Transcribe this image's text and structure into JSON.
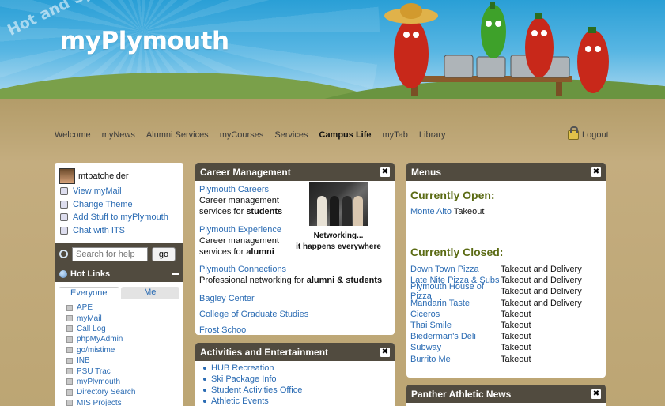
{
  "header": {
    "tagline": "Hot and Spicy!",
    "logo": "myPlymouth"
  },
  "nav": {
    "items": [
      "Welcome",
      "myNews",
      "Alumni Services",
      "myCourses",
      "Services",
      "Campus Life",
      "myTab",
      "Library"
    ],
    "active": "Campus Life",
    "logout": "Logout"
  },
  "sidebar": {
    "username": "mtbatchelder",
    "actions": [
      "View myMail",
      "Change Theme",
      "Add Stuff to myPlymouth",
      "Chat with ITS"
    ],
    "search": {
      "placeholder": "Search for help",
      "button": "go"
    },
    "hot_links": {
      "title": "Hot Links",
      "tabs": [
        "Everyone",
        "Me"
      ],
      "items": [
        "APE",
        "myMail",
        "Call Log",
        "phpMyAdmin",
        "go/mistime",
        "INB",
        "PSU Trac",
        "myPlymouth",
        "Directory Search",
        "MIS Projects"
      ]
    }
  },
  "career": {
    "title": "Career Management",
    "items": [
      {
        "link": "Plymouth Careers",
        "desc": "Career management services for",
        "bold": "students"
      },
      {
        "link": "Plymouth Experience",
        "desc": "Career management services for",
        "bold": "alumni"
      },
      {
        "link": "Plymouth Connections",
        "desc": "Professional networking for",
        "bold": "alumni & students"
      }
    ],
    "more_links": [
      "Bagley Center",
      "College of Graduate Studies",
      "Frost School"
    ],
    "caption_line1": "Networking...",
    "caption_line2": "it happens everywhere"
  },
  "activities": {
    "title": "Activities and Entertainment",
    "items": [
      "HUB Recreation",
      "Ski Package Info",
      "Student Activities Office",
      "Athletic Events"
    ]
  },
  "menus": {
    "title": "Menus",
    "open_heading": "Currently Open:",
    "open": [
      {
        "name": "Monte Alto",
        "status": "Takeout"
      }
    ],
    "closed_heading": "Currently Closed:",
    "closed": [
      {
        "name": "Down Town Pizza",
        "status": "Takeout and Delivery"
      },
      {
        "name": "Late Nite Pizza & Subs",
        "status": "Takeout and Delivery"
      },
      {
        "name": "Plymouth House of Pizza",
        "status": "Takeout and Delivery"
      },
      {
        "name": "Mandarin Taste",
        "status": "Takeout and Delivery"
      },
      {
        "name": "Ciceros",
        "status": "Takeout"
      },
      {
        "name": "Thai Smile",
        "status": "Takeout"
      },
      {
        "name": "Biederman's Deli",
        "status": "Takeout"
      },
      {
        "name": "Subway",
        "status": "Takeout"
      },
      {
        "name": "Burrito Me",
        "status": "Takeout"
      }
    ]
  },
  "athletic": {
    "title": "Panther Athletic News"
  },
  "close_symbol": "✖"
}
